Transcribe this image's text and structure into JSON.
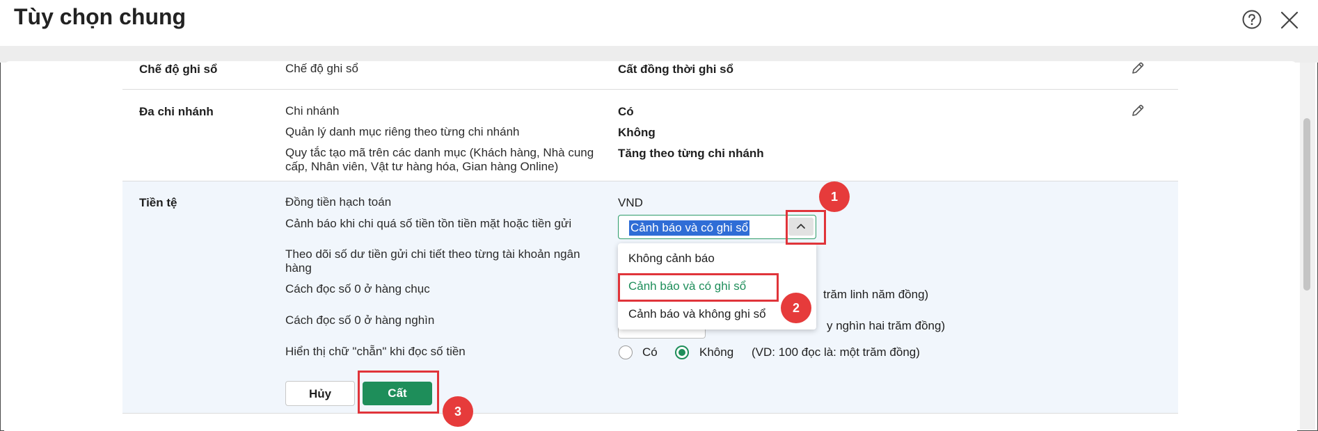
{
  "dialog": {
    "title": "Tùy chọn chung",
    "help_icon": "help-circle-icon",
    "close_icon": "close-icon"
  },
  "sections": {
    "posting_mode": {
      "label": "Chế độ ghi sổ",
      "fields": [
        {
          "label": "Chế độ ghi sổ",
          "value": "Cất đồng thời ghi sổ"
        }
      ],
      "edit_icon": "pencil-icon"
    },
    "multi_branch": {
      "label": "Đa chi nhánh",
      "fields": [
        {
          "label": "Chi nhánh",
          "value": "Có"
        },
        {
          "label": "Quản lý danh mục riêng theo từng chi nhánh",
          "value": "Không"
        },
        {
          "label_line1": "Quy tắc tạo mã trên các danh mục (Khách hàng, Nhà cung",
          "label_line2": "cấp, Nhân viên, Vật tư hàng hóa, Gian hàng Online)",
          "value": "Tăng theo từng chi nhánh"
        }
      ],
      "edit_icon": "pencil-icon"
    },
    "currency": {
      "label": "Tiền tệ",
      "accounting_currency_label": "Đồng tiền hạch toán",
      "accounting_currency_value": "VND",
      "overspend_warning_label": "Cảnh báo khi chi quá số tiền tồn tiền mặt hoặc tiền gửi",
      "overspend_warning_selected": "Cảnh báo và có ghi sổ",
      "overspend_warning_options": [
        "Không cảnh báo",
        "Cảnh báo và có ghi sổ",
        "Cảnh báo và không ghi sổ"
      ],
      "track_deposit_label_line1": "Theo dõi số dư tiền gửi chi tiết theo từng tài khoản ngân",
      "track_deposit_label_line2": "hàng",
      "zero_tens_label": "Cách đọc số 0 ở hàng chục",
      "zero_tens_example": "trăm linh năm đồng)",
      "zero_thousands_label": "Cách đọc số 0 ở hàng nghìn",
      "zero_thousands_example": "y nghìn hai trăm đồng)",
      "show_chan_label": "Hiển thị chữ \"chẵn\" khi đọc số tiền",
      "show_chan_options": [
        "Có",
        "Không"
      ],
      "show_chan_selected": "Không",
      "show_chan_example": "(VD: 100 đọc là: một trăm đồng)"
    }
  },
  "buttons": {
    "cancel": "Hủy",
    "save": "Cất"
  },
  "annotations": [
    "1",
    "2",
    "3"
  ],
  "colors": {
    "accent_green": "#1e8e5a",
    "highlight_red": "#e0343a",
    "selection_blue": "#2f6dd6"
  }
}
